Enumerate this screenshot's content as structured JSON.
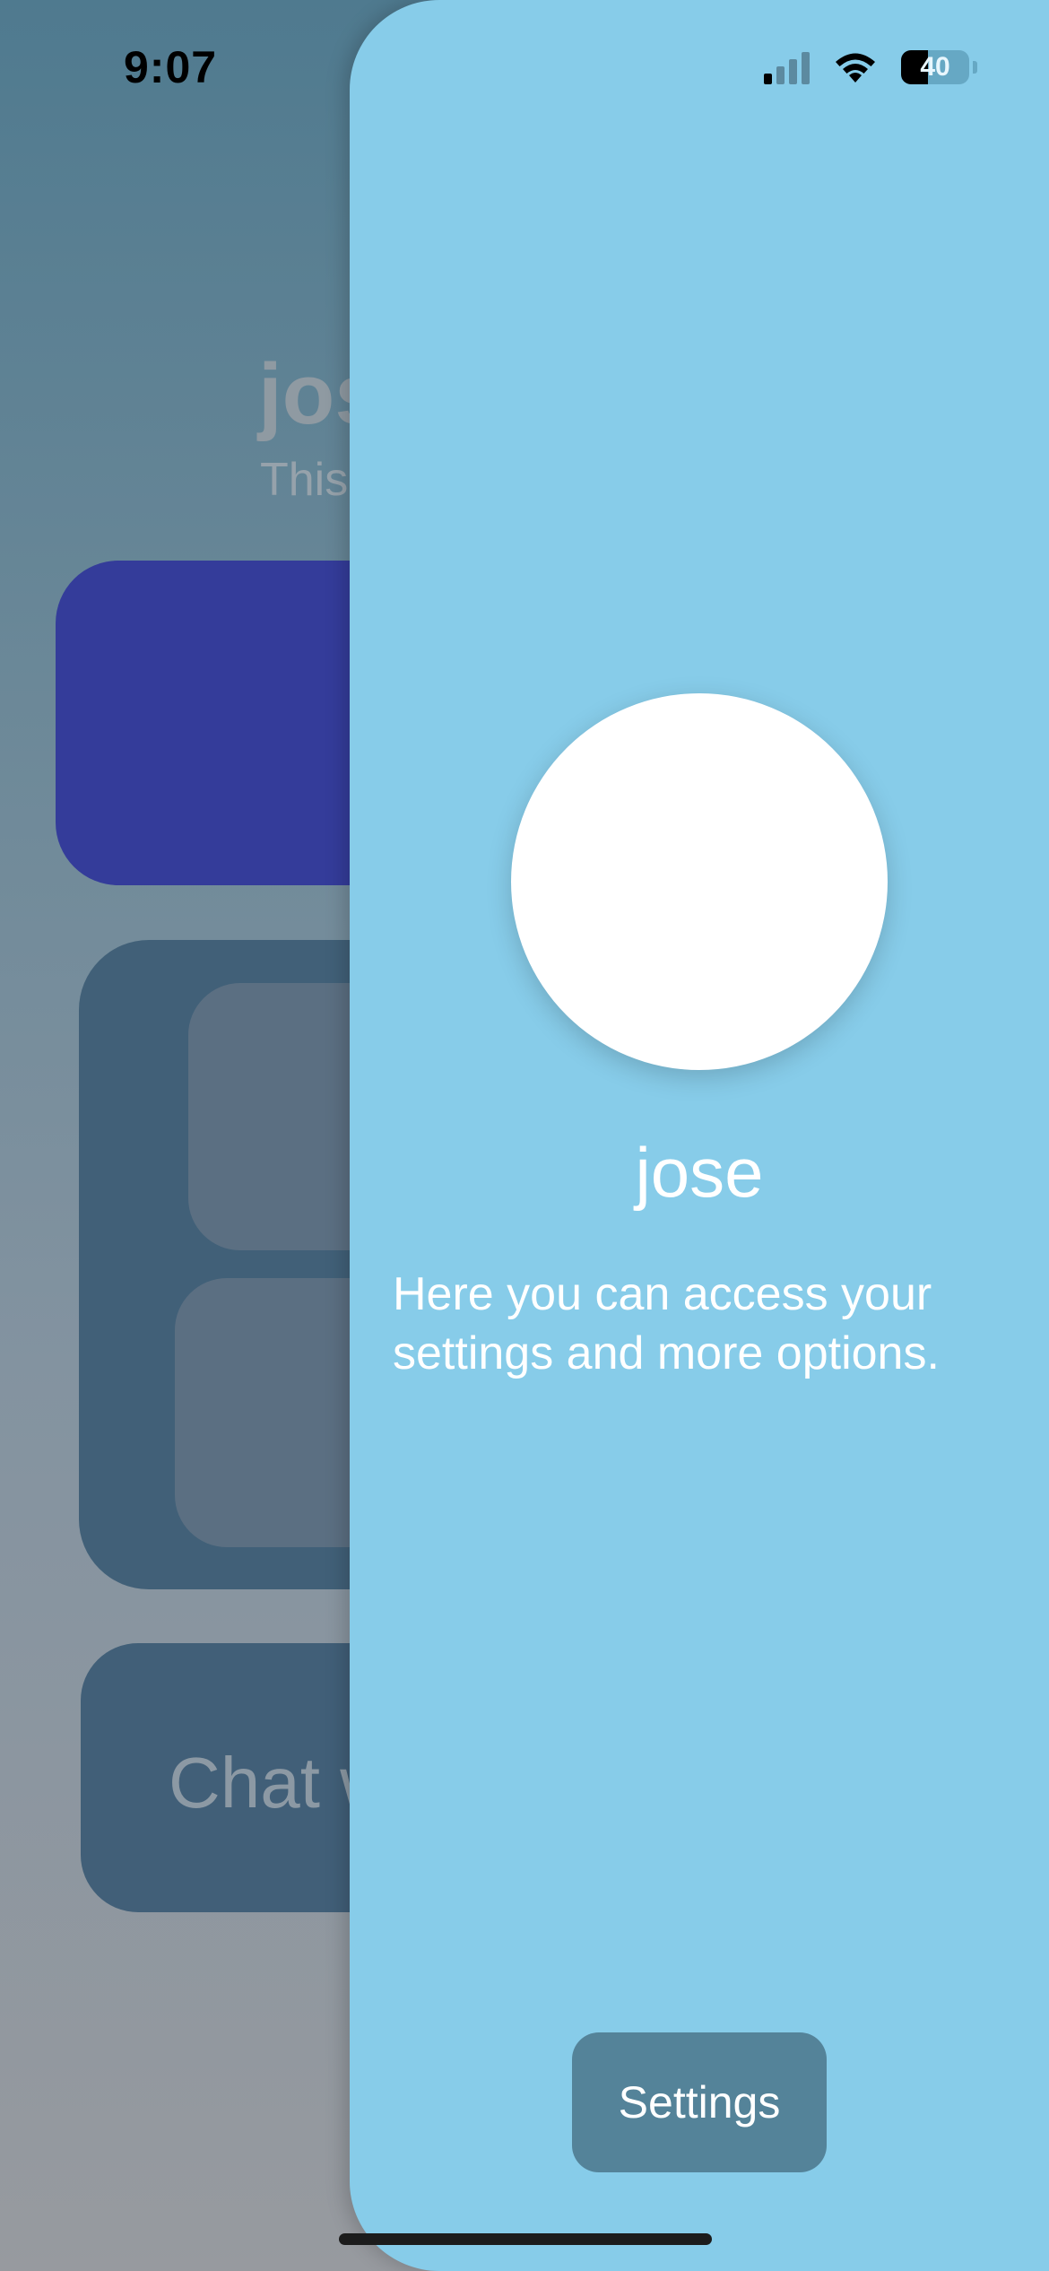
{
  "status_bar": {
    "time": "9:07",
    "battery_percent": "40",
    "signal_bars_active": 1,
    "signal_bars_total": 4,
    "icons": [
      "cellular-signal-icon",
      "wifi-icon",
      "battery-icon"
    ]
  },
  "background_screen": {
    "title_fragment": "jos",
    "subtitle_fragment": "This",
    "chat_card_fragment": "Chat w"
  },
  "panel": {
    "username": "jose",
    "description": "Here you can access your settings and more options.",
    "settings_label": "Settings"
  },
  "colors": {
    "panel_background": "#87cce9",
    "settings_button": "#548399",
    "avatar": "#ffffff",
    "background_blue_card": "#343c9a",
    "background_dark_card": "#416078"
  }
}
